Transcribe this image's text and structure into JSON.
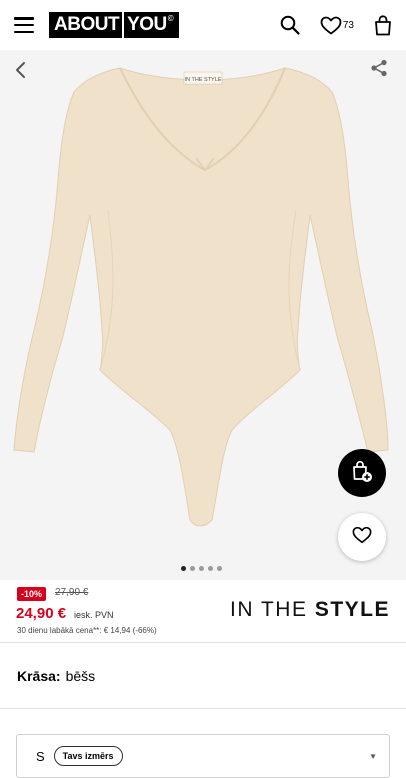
{
  "header": {
    "logo_left": "ABOUT",
    "logo_right": "YOU",
    "wishlist_count": "73",
    "icons": [
      "menu-icon",
      "search-icon",
      "heart-icon",
      "shopping-bag-icon"
    ]
  },
  "gallery": {
    "slide_count": 5,
    "active_slide": 1,
    "product_label": "IN THE STYLE",
    "icons": [
      "chevron-left-icon",
      "share-icon",
      "add-to-bag-icon",
      "heart-icon"
    ]
  },
  "price": {
    "discount": "-10%",
    "old_price": "27,90 €",
    "current_price": "24,90 €",
    "vat_note": "iesk. PVN",
    "lowest_price_note": "30 dienu labākā cena**: € 14,94 (-66%)"
  },
  "brand": {
    "name_light": "IN THE ",
    "name_bold": "STYLE"
  },
  "color": {
    "label": "Krāsa:",
    "value": "bēšs"
  },
  "size": {
    "value": "S",
    "pill": "Tavs izmērs"
  },
  "colors": {
    "price_red": "#d6001c",
    "product_beige": "#f0e1cb",
    "gallery_bg": "#f4f4f4"
  }
}
